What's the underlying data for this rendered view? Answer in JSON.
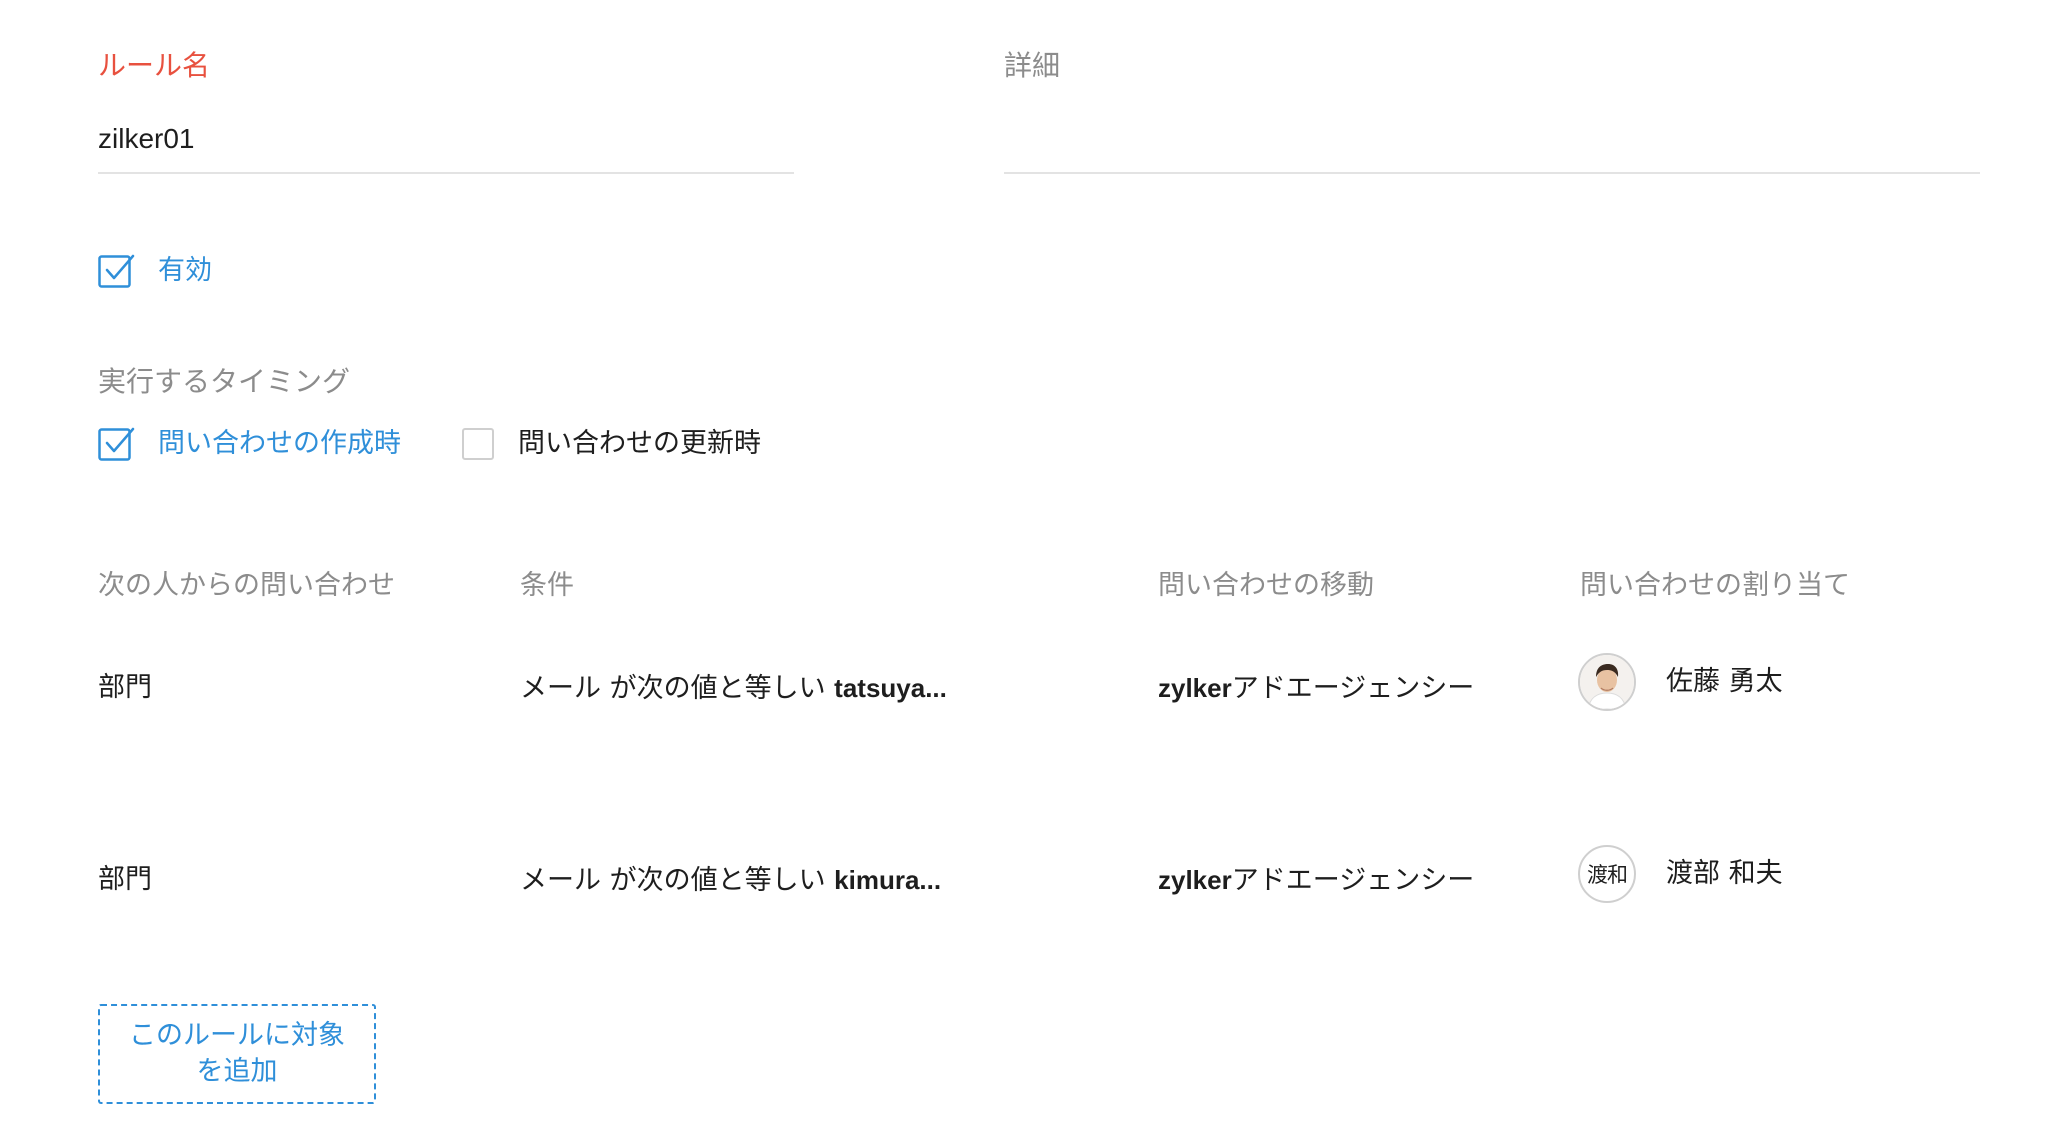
{
  "form": {
    "rule_name_label": "ルール名",
    "rule_name_value": "zilker01",
    "description_label": "詳細",
    "description_value": "",
    "enabled_label": "有効",
    "enabled_checked": true
  },
  "timing": {
    "label": "実行するタイミング",
    "on_create_label": "問い合わせの作成時",
    "on_create_checked": true,
    "on_update_label": "問い合わせの更新時",
    "on_update_checked": false
  },
  "table": {
    "headers": {
      "from": "次の人からの問い合わせ",
      "condition": "条件",
      "move": "問い合わせの移動",
      "assign": "問い合わせの割り当て"
    },
    "rows": [
      {
        "from": "部門",
        "condition_prefix": "メール が次の値と等しい ",
        "condition_value": "tatsuya...",
        "department_latin": "zylker",
        "department_rest": "アドエージェンシー",
        "avatar_type": "photo",
        "assignee": "佐藤 勇太"
      },
      {
        "from": "部門",
        "condition_prefix": "メール が次の値と等しい ",
        "condition_value": "kimura...",
        "department_latin": "zylker",
        "department_rest": "アドエージェンシー",
        "avatar_type": "initials",
        "avatar_initials": "渡和",
        "assignee": "渡部 和夫"
      }
    ]
  },
  "actions": {
    "add_target_label": "このルールに対象を追加"
  },
  "colors": {
    "required_label": "#e8513f",
    "accent": "#2f8fd9",
    "muted": "#8c8c8c",
    "text": "#1e1e1e",
    "divider": "#e3e3e3"
  }
}
